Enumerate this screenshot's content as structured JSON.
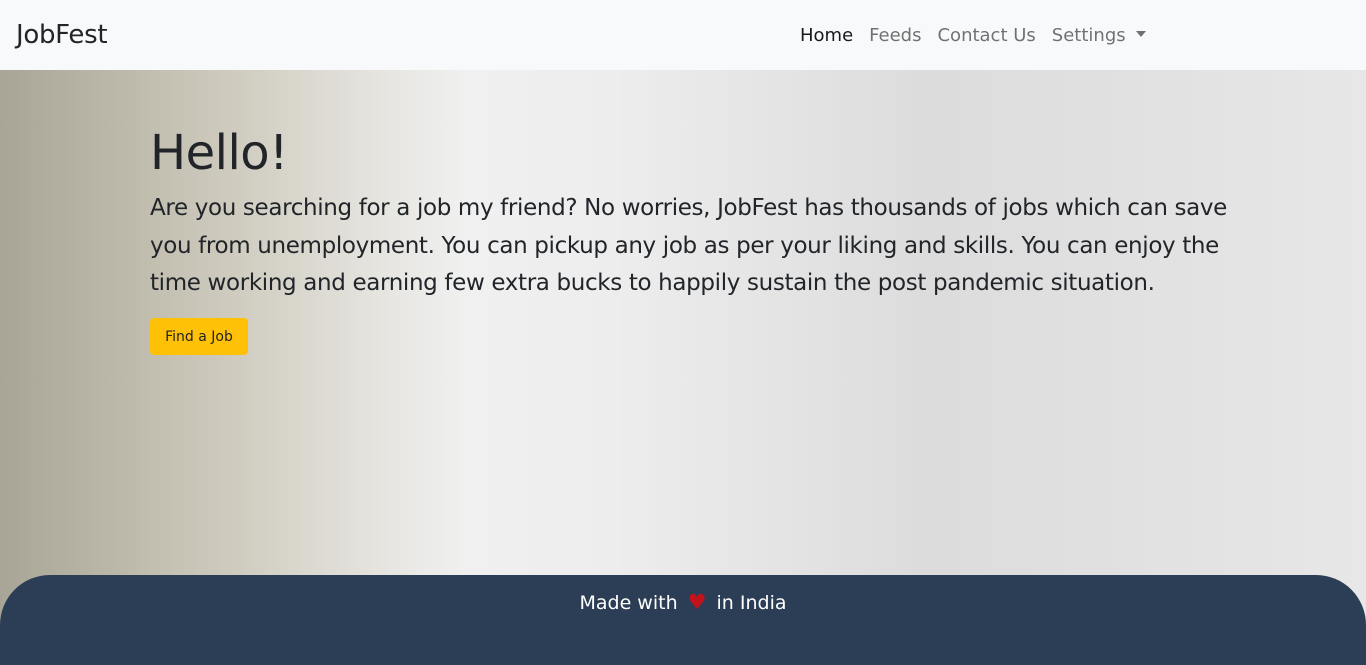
{
  "navbar": {
    "brand": "JobFest",
    "links": [
      {
        "label": "Home"
      },
      {
        "label": "Feeds"
      },
      {
        "label": "Contact Us"
      },
      {
        "label": "Settings"
      }
    ]
  },
  "hero": {
    "title": "Hello!",
    "text": "Are you searching for a job my friend? No worries, JobFest has thousands of jobs which can save you from unemployment. You can pickup any job as per your liking and skills. You can enjoy the time working and earning few extra bucks to happily sustain the post pandemic situation.",
    "button_label": "Find a Job"
  },
  "footer": {
    "text_before": "Made with",
    "heart": "♥",
    "text_after": "in India"
  },
  "colors": {
    "navbar_bg": "#f8f9fa",
    "button_bg": "#ffc107",
    "footer_bg": "#2c3e55",
    "heart": "#c0131a"
  }
}
